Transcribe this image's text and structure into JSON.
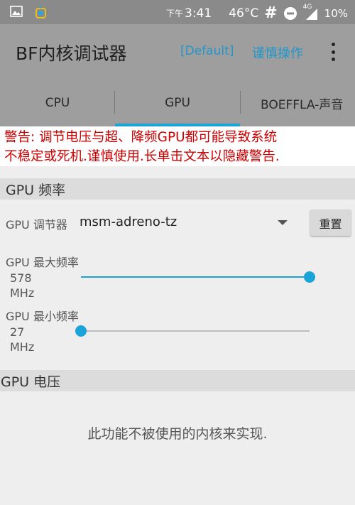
{
  "status_bar": {
    "time_prefix": "下午",
    "time": "3:41",
    "temperature": "46°C",
    "hash": "#",
    "network": "4G",
    "battery": "10%"
  },
  "app_bar": {
    "title": "BF内核调试器",
    "profile": "[Default]",
    "caution": "谨慎操作"
  },
  "tabs": [
    {
      "label": "CPU"
    },
    {
      "label": "GPU"
    },
    {
      "label": "BOEFFLA-声音"
    }
  ],
  "active_tab": "GPU",
  "warning": {
    "line1": "警告: 调节电压与超、降频GPU都可能导致系统",
    "line2": "不稳定或死机.谨慎使用.长单击文本以隐藏警告."
  },
  "gpu_freq": {
    "header": "GPU 频率",
    "governor_label": "GPU 调节器",
    "governor_value": "msm-adreno-tz",
    "reset_label": "重置",
    "max": {
      "label": "GPU 最大频率",
      "value": "578",
      "unit": "MHz",
      "fraction": 1.0
    },
    "min": {
      "label": "GPU 最小频率",
      "value": "27",
      "unit": "MHz",
      "fraction": 0.0
    }
  },
  "gpu_voltage": {
    "header": "GPU 电压",
    "message": "此功能不被使用的内核来实现."
  },
  "colors": {
    "accent": "#1aa3d6",
    "warning": "#cc0000",
    "link": "#2196c9"
  }
}
